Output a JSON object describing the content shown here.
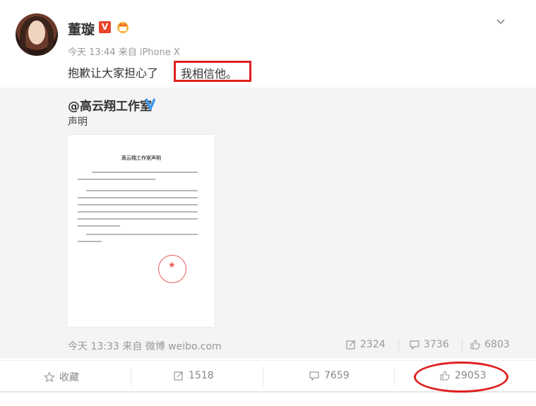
{
  "post": {
    "author": "董璇",
    "meta": "今天 13:44 来自 iPhone X",
    "text": "抱歉让大家担心了",
    "highlighted_text": "我相信他。",
    "badges": [
      "v-badge",
      "crown-icon"
    ]
  },
  "repost": {
    "author": "@高云翔工作室",
    "text": "声明",
    "document_title": "高云翔工作室声明",
    "meta": "今天 13:33 来自 微博 weibo.com",
    "stats": {
      "reposts": "2324",
      "comments": "3736",
      "likes": "6803"
    }
  },
  "actions": {
    "favorite": "收藏",
    "repost": "1518",
    "comment": "7659",
    "like": "29053"
  },
  "colors": {
    "accent_red": "#e02020",
    "meta_gray": "#999999",
    "v_blue": "#3d96f5"
  }
}
